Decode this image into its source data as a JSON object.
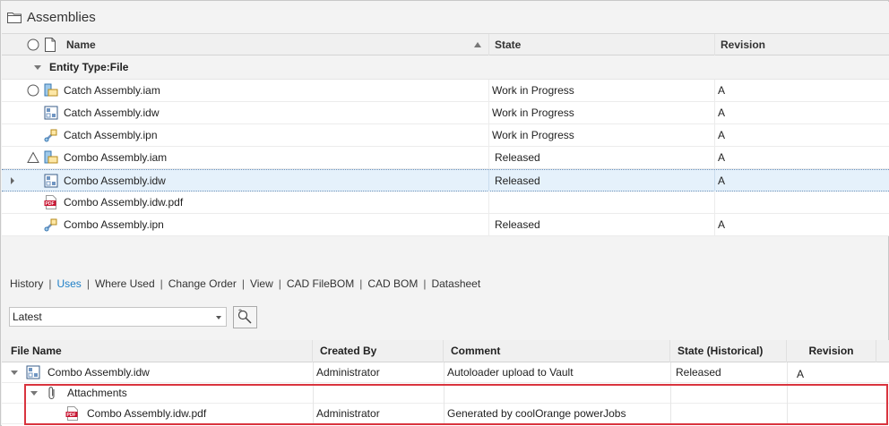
{
  "panel": {
    "title": "Assemblies"
  },
  "grid": {
    "columns": [
      "Name",
      "State",
      "Revision"
    ],
    "group_label": "Entity Type:File",
    "rows": [
      {
        "name": "Catch Assembly.iam",
        "state": "Work in Progress",
        "revision": "A",
        "icon": "assembly-icon",
        "status": "circle-status-icon"
      },
      {
        "name": "Catch Assembly.idw",
        "state": "Work in Progress",
        "revision": "A",
        "icon": "drawing-icon",
        "status": ""
      },
      {
        "name": "Catch Assembly.ipn",
        "state": "Work in Progress",
        "revision": "A",
        "icon": "presentation-icon",
        "status": ""
      },
      {
        "name": "Combo Assembly.iam",
        "state": "Released",
        "revision": "A",
        "icon": "assembly-icon",
        "status": "triangle-status-icon"
      },
      {
        "name": "Combo Assembly.idw",
        "state": "Released",
        "revision": "A",
        "icon": "drawing-icon",
        "status": "",
        "selected": true
      },
      {
        "name": "Combo Assembly.idw.pdf",
        "state": "",
        "revision": "",
        "icon": "pdf-icon",
        "status": ""
      },
      {
        "name": "Combo Assembly.ipn",
        "state": "Released",
        "revision": "A",
        "icon": "presentation-icon",
        "status": ""
      }
    ]
  },
  "tabs": [
    "History",
    "Uses",
    "Where Used",
    "Change Order",
    "View",
    "CAD FileBOM",
    "CAD BOM",
    "Datasheet"
  ],
  "active_tab": "Uses",
  "version_select": {
    "value": "Latest"
  },
  "uses_grid": {
    "columns": [
      "File Name",
      "Created By",
      "Comment",
      "State (Historical)",
      "Revision"
    ],
    "rows": [
      {
        "name": "Combo Assembly.idw",
        "created_by": "Administrator",
        "comment": "Autoloader upload to Vault",
        "state": "Released",
        "revision": "A",
        "icon": "drawing-icon"
      },
      {
        "name": "Attachments",
        "created_by": "",
        "comment": "",
        "state": "",
        "revision": "",
        "icon": "paperclip-icon"
      },
      {
        "name": "Combo Assembly.idw.pdf",
        "created_by": "Administrator",
        "comment": "Generated by coolOrange powerJobs",
        "state": "",
        "revision": "",
        "icon": "pdf-icon"
      }
    ]
  },
  "colors": {
    "accent": "#1e7fc7",
    "selection": "#e5f1fb",
    "highlight": "#d9343e",
    "pdf": "#c8102e"
  }
}
